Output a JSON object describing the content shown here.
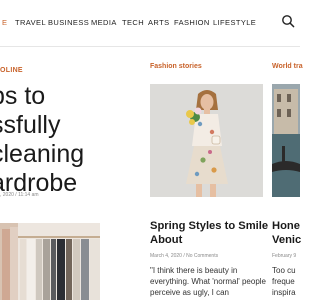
{
  "nav": {
    "items": [
      {
        "label": "E",
        "active": true
      },
      {
        "label": "TRAVEL",
        "active": false
      },
      {
        "label": "BUSINESS",
        "active": false
      },
      {
        "label": "MEDIA",
        "active": false
      },
      {
        "label": "TECH",
        "active": false
      },
      {
        "label": "ARTS",
        "active": false
      },
      {
        "label": "FASHION",
        "active": false
      },
      {
        "label": "LIFESTYLE",
        "active": false
      }
    ],
    "search_icon": "search-icon",
    "accent_color": "#c8622a"
  },
  "featured": {
    "category": "OLINE",
    "title": "ps to\nssfully\ncleaning\nardrobe",
    "meta": ", 2020 / 11:14 am",
    "image": "clothing-rack-photo"
  },
  "middle": {
    "section": "Fashion stories",
    "image": "woman-with-flowers-photo",
    "title": "Spring Styles to Smile About",
    "meta": "March 4, 2020 / No Comments",
    "excerpt": "\"I think there is beauty in everything. What 'normal' people perceive as ugly, I can"
  },
  "right": {
    "section": "World tra",
    "image": "venice-photo",
    "title": "Hone\nVenic",
    "meta": "February 9",
    "excerpt": "Too cu\nfreque\ninspira"
  }
}
